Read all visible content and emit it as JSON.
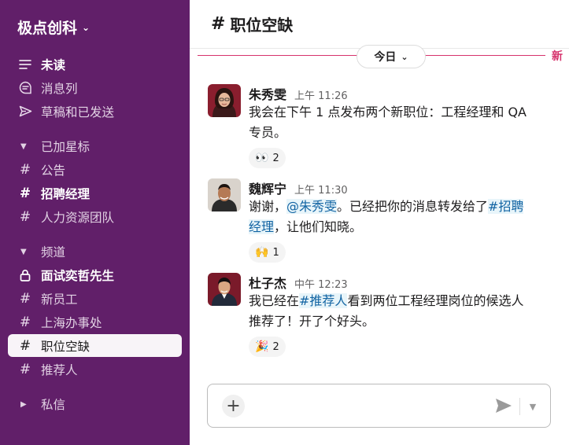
{
  "workspace": {
    "name": "极点创科"
  },
  "sidebar": {
    "top_items": [
      {
        "label": "未读",
        "icon": "unread-icon"
      },
      {
        "label": "消息列",
        "icon": "threads-icon"
      },
      {
        "label": "草稿和已发送",
        "icon": "send-icon"
      }
    ],
    "starred": {
      "title": "已加星标",
      "items": [
        {
          "label": "公告"
        },
        {
          "label": "招聘经理"
        },
        {
          "label": "人力资源团队"
        }
      ]
    },
    "channels": {
      "title": "频道",
      "items": [
        {
          "label": "面试奕哲先生"
        },
        {
          "label": "新员工"
        },
        {
          "label": "上海办事处"
        },
        {
          "label": "职位空缺"
        },
        {
          "label": "推荐人"
        }
      ]
    },
    "dms": {
      "title": "私信"
    }
  },
  "channel": {
    "name": "职位空缺",
    "day_label": "今日",
    "new_label": "新"
  },
  "messages": [
    {
      "author": "朱秀雯",
      "time": "上午 11:26",
      "line1": "我会在下午 1 点发布两个新职位：工程经理和 QA",
      "line2": "专员。",
      "reaction": {
        "emoji": "👀",
        "count": "2"
      }
    },
    {
      "author": "魏辉宁",
      "time": "上午 11:30",
      "p1": "谢谢，",
      "mention": "@朱秀雯",
      "p2": "。已经把你的消息转发给了",
      "chan_a": "#招聘",
      "chan_b": "经理",
      "p3": "，让他们知晓。",
      "reaction": {
        "emoji": "🙌",
        "count": "1"
      }
    },
    {
      "author": "杜子杰",
      "time": "中午 12:23",
      "p1": "我已经在",
      "chan": "#推荐人",
      "p2": "看到两位工程经理岗位的候选人",
      "line2": "推荐了！开了个好头。",
      "reaction": {
        "emoji": "🎉",
        "count": "2"
      }
    }
  ],
  "colors": {
    "sidebar_bg": "#611f69",
    "new_divider": "#d6336c",
    "link": "#1264a3"
  }
}
